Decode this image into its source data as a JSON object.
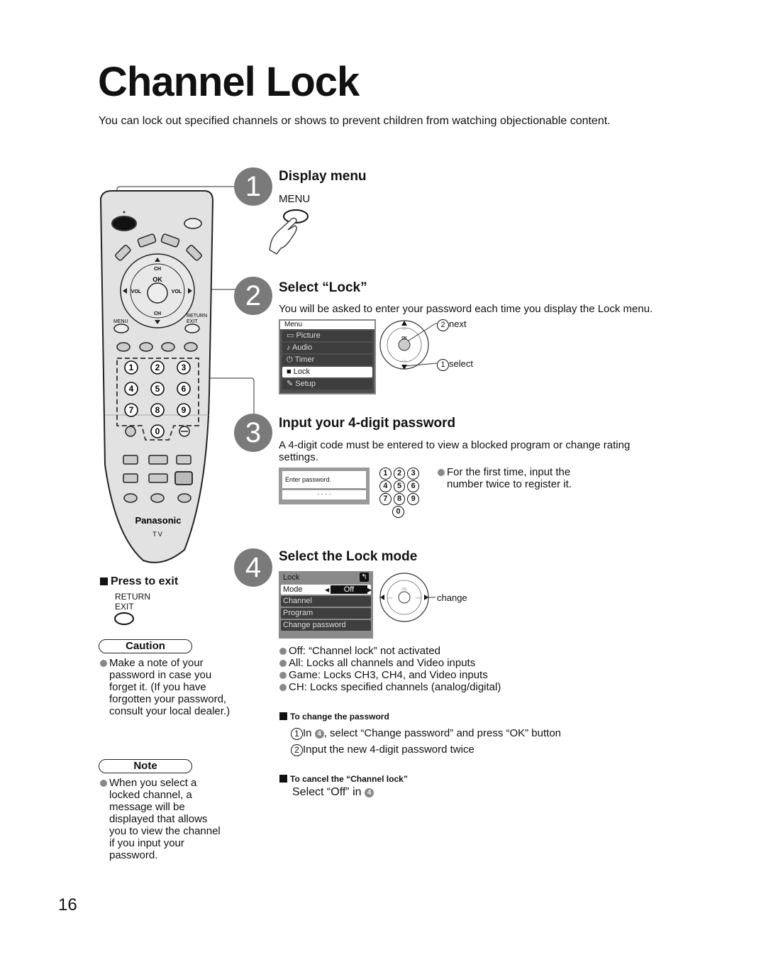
{
  "page": {
    "title": "Channel Lock",
    "intro": "You can lock out specified channels or shows to prevent children from watching objectionable content.",
    "page_number": "16"
  },
  "remote": {
    "brand": "Panasonic",
    "model_label": "TV",
    "labels": {
      "ch": "CH",
      "ok": "OK",
      "vol": "VOL",
      "menu": "MENU",
      "return": "RETURN",
      "exit": "EXIT"
    },
    "digits": [
      "1",
      "2",
      "3",
      "4",
      "5",
      "6",
      "7",
      "8",
      "9",
      "0"
    ]
  },
  "steps": [
    {
      "number": "1",
      "title": "Display menu",
      "button_label": "MENU"
    },
    {
      "number": "2",
      "title": "Select “Lock”",
      "description": "You will be asked to enter your password each time you display the Lock menu.",
      "menu": {
        "header": "Menu",
        "items": [
          {
            "icon": "picture-icon",
            "glyph": "▭",
            "label": "Picture"
          },
          {
            "icon": "audio-icon",
            "glyph": "♪",
            "label": "Audio"
          },
          {
            "icon": "timer-icon",
            "glyph": "⏻",
            "label": "Timer"
          },
          {
            "icon": "lock-icon",
            "glyph": "■",
            "label": "Lock",
            "selected": true
          },
          {
            "icon": "setup-icon",
            "glyph": "✎",
            "label": "Setup"
          }
        ]
      },
      "dpad": {
        "ok": "OK",
        "ch": "CH",
        "vol": "VOL"
      },
      "callouts": {
        "next_num": "2",
        "next": "next",
        "select_num": "1",
        "select": "select"
      }
    },
    {
      "number": "3",
      "title": "Input your 4-digit password",
      "description": "A 4-digit code must be entered to view a blocked program or change rating settings.",
      "password_box": {
        "prompt": "Enter password.",
        "value": "- - - -"
      },
      "keypad": [
        "1",
        "2",
        "3",
        "4",
        "5",
        "6",
        "7",
        "8",
        "9",
        "0"
      ],
      "note": "For the first time, input the number twice to register it."
    },
    {
      "number": "4",
      "title": "Select the Lock mode",
      "lock_menu": {
        "header": "Lock",
        "mode_label": "Mode",
        "mode_value": "Off",
        "items": [
          "Channel",
          "Program",
          "Change password"
        ]
      },
      "dpad": {
        "ok": "OK",
        "ch": "CH",
        "vol": "VOL"
      },
      "callout": "change",
      "modes": [
        "Off: “Channel lock” not activated",
        "All: Locks all channels and Video inputs",
        "Game: Locks CH3, CH4, and Video inputs",
        "CH: Locks specified channels (analog/digital)"
      ]
    }
  ],
  "change_password": {
    "heading": "To change the password",
    "steps": [
      {
        "num": "1",
        "pre": "In ",
        "ref": "4",
        "post": ", select “Change password” and press “OK” button"
      },
      {
        "num": "2",
        "text": "Input the new 4-digit password twice"
      }
    ]
  },
  "cancel_lock": {
    "heading": "To cancel the “Channel lock”",
    "pre": "Select “Off” in ",
    "ref": "4"
  },
  "press_to_exit": {
    "heading": "Press to exit",
    "label_line1": "RETURN",
    "label_line2": "EXIT"
  },
  "caution": {
    "title": "Caution",
    "text": "Make a note of your password in case you forget it. (If you have forgotten your password, consult your local dealer.)"
  },
  "note": {
    "title": "Note",
    "text": "When you select a locked channel, a message will be displayed that allows you to view the channel if you input your password."
  }
}
